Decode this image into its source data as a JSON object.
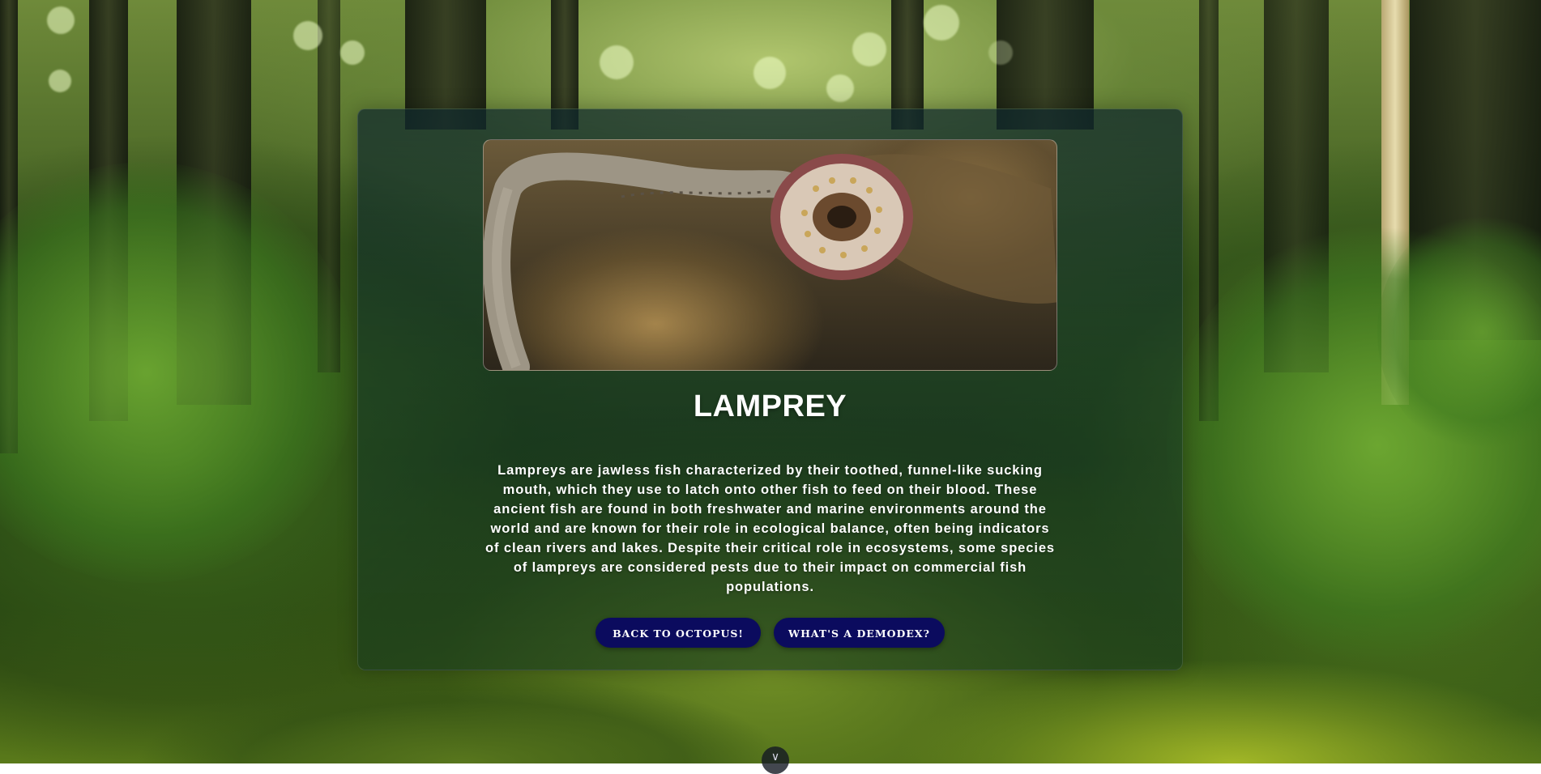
{
  "card": {
    "title": "LAMPREY",
    "image_alt": "Lamprey with round toothed sucking mouth underwater",
    "description": "Lampreys are jawless fish characterized by their toothed, funnel-like sucking mouth, which they use to latch onto other fish to feed on their blood. These ancient fish are found in both freshwater and marine environments around the world and are known for their role in ecological balance, often being indicators of clean rivers and lakes. Despite their critical role in ecosystems, some species of lampreys are considered pests due to their impact on commercial fish populations."
  },
  "buttons": {
    "back_label": "BACK TO OCTOPUS!",
    "next_label": "WHAT'S A DEMODEX?"
  },
  "scroll": {
    "icon": "chevron-down-icon",
    "glyph": "∨"
  },
  "colors": {
    "button_bg": "#0b0b5e",
    "text": "#ffffff"
  }
}
